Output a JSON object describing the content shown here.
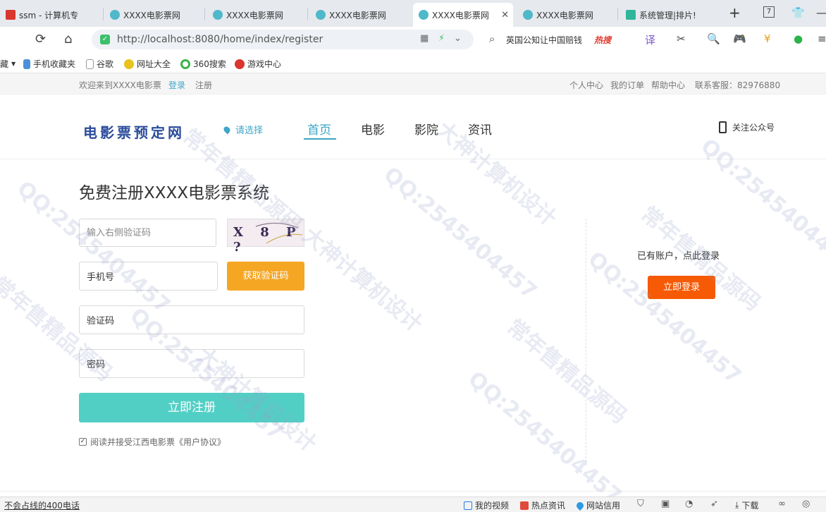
{
  "browser": {
    "tabs": [
      {
        "label": "ssm - 计算机专",
        "active": false
      },
      {
        "label": "XXXX电影票网",
        "active": false
      },
      {
        "label": "XXXX电影票网",
        "active": false
      },
      {
        "label": "XXXX电影票网",
        "active": false
      },
      {
        "label": "XXXX电影票网",
        "active": true
      },
      {
        "label": "XXXX电影票网",
        "active": false
      },
      {
        "label": "系统管理|排片!",
        "active": false
      }
    ],
    "new_tab": "+",
    "tab_count": "7",
    "url": "http://localhost:8080/home/index/register",
    "search_query": "英国公知让中国赔钱",
    "search_hot": "热搜",
    "bookmarks": [
      "藏",
      "手机收藏夹",
      "谷歌",
      "网址大全",
      "360搜索",
      "游戏中心"
    ]
  },
  "site": {
    "welcome": "欢迎来到XXXX电影票",
    "login_link": "登录",
    "register_link": "注册",
    "top_links": [
      "个人中心",
      "我的订单",
      "帮助中心"
    ],
    "service": "联系客服：82976880",
    "logo": "电影票预定网",
    "city": "请选择",
    "nav": [
      "首页",
      "电影",
      "影院",
      "资讯"
    ],
    "follow": "关注公众号"
  },
  "register": {
    "title": "免费注册XXXX电影票系统",
    "captcha_placeholder": "输入右侧验证码",
    "captcha_text": "X 8 P ?",
    "phone_label": "手机号",
    "get_code": "获取验证码",
    "code_label": "验证码",
    "password_label": "密码",
    "submit": "立即注册",
    "agree": "阅读并接受江西电影票《用户协议》"
  },
  "login_side": {
    "have_account": "已有账户，点此登录",
    "login_button": "立即登录"
  },
  "statusbar": {
    "left": "不会占线的400电话",
    "items": [
      "我的视频",
      "热点资讯",
      "网站信用"
    ],
    "download": "下载"
  },
  "watermark": {
    "qq": "QQ:2545404457",
    "a": "大神计算机设计",
    "b": "常年售精品源码"
  },
  "colors": {
    "accent": "#3aa6c4",
    "submit": "#52cfc5",
    "get_code": "#f5a623",
    "login": "#f65a05",
    "logo": "#2b4c9b"
  }
}
